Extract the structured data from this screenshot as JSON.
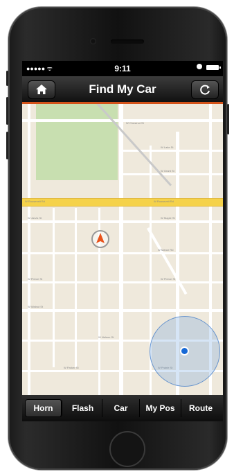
{
  "status_bar": {
    "signal": "●●●●● ᯤ",
    "time": "9:11"
  },
  "header": {
    "title": "Find My Car"
  },
  "map": {
    "street_labels": [
      "W Roosevelt Rd",
      "W Roosevelt Rd",
      "W Jarvis St",
      "W Maple St",
      "W Manor Rd",
      "W Pierce St",
      "W Pierce St",
      "W Walnut St",
      "W Nelson St",
      "W Lake St",
      "W Grant St",
      "W Prairie St",
      "W Parker St",
      "W Chestnut St"
    ]
  },
  "tabs": [
    "Horn",
    "Flash",
    "Car",
    "My Pos",
    "Route"
  ],
  "active_tab": "Horn",
  "colors": {
    "accent": "#d4531a",
    "car_marker": "#e8531c",
    "position_dot": "#1769d6",
    "highway": "#f5d24a",
    "park": "#c8dfb0"
  },
  "icons": {
    "home": "home-icon",
    "refresh": "refresh-icon",
    "horn": "horn-icon",
    "car": "car-arrow-icon"
  }
}
